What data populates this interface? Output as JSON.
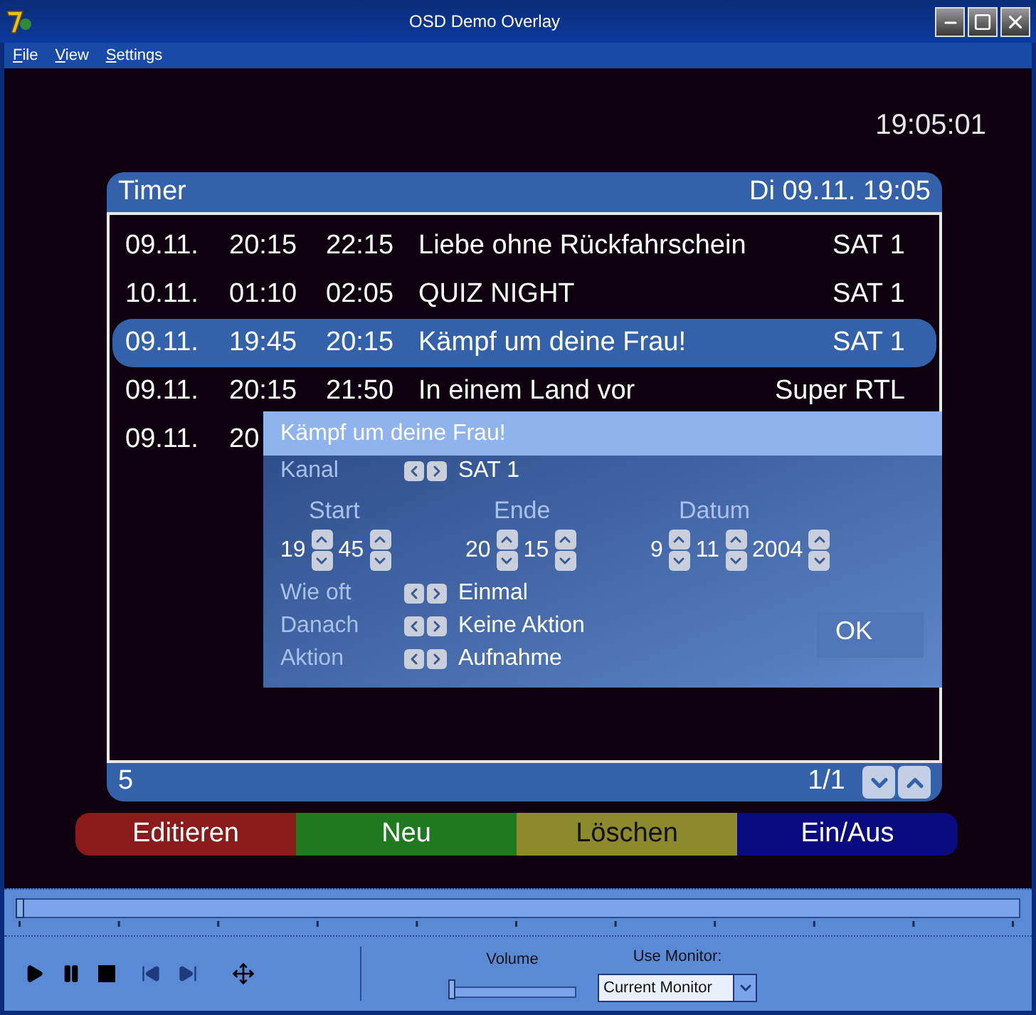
{
  "window": {
    "title": "OSD Demo Overlay"
  },
  "menu": [
    "File",
    "View",
    "Settings"
  ],
  "clock": "19:05:01",
  "timer": {
    "title": "Timer",
    "datetime": "Di 09.11. 19:05",
    "rows": [
      {
        "cells": [
          "09.11.",
          "20:15",
          "22:15",
          "Liebe ohne Rückfahrschein",
          "SAT 1"
        ],
        "selected": false
      },
      {
        "cells": [
          "10.11.",
          "01:10",
          "02:05",
          "QUIZ NIGHT",
          "SAT 1"
        ],
        "selected": false
      },
      {
        "cells": [
          "09.11.",
          "19:45",
          "20:15",
          "Kämpf um deine Frau!",
          "SAT 1"
        ],
        "selected": true
      },
      {
        "cells": [
          "09.11.",
          "20:15",
          "21:50",
          "In einem Land vor",
          "Super RTL"
        ],
        "selected": false
      },
      {
        "cells": [
          "09.11.",
          "20"
        ],
        "selected": false
      }
    ],
    "count": "5",
    "page": "1/1"
  },
  "color_buttons": [
    {
      "label": "Editieren",
      "color": "#8b1a1a"
    },
    {
      "label": "Neu",
      "color": "#1f7a1f"
    },
    {
      "label": "Löschen",
      "color": "#8c8a2a"
    },
    {
      "label": "Ein/Aus",
      "color": "#0a0a80"
    }
  ],
  "dialog": {
    "title": "Kämpf um deine Frau!",
    "channel": {
      "label": "Kanal",
      "value": "SAT 1"
    },
    "spinners": [
      {
        "label": "Start",
        "fields": [
          "19",
          "45"
        ]
      },
      {
        "label": "Ende",
        "fields": [
          "20",
          "15"
        ]
      },
      {
        "label": "Datum",
        "fields": [
          "9",
          "11",
          "2004"
        ]
      }
    ],
    "options": [
      {
        "label": "Wie oft",
        "value": "Einmal"
      },
      {
        "label": "Danach",
        "value": "Keine Aktion"
      },
      {
        "label": "Aktion",
        "value": "Aufnahme"
      }
    ],
    "ok": "OK"
  },
  "player": {
    "position": {
      "level": 0
    },
    "volume": {
      "label": "Volume",
      "level": 0
    },
    "monitor": {
      "label": "Use Monitor:",
      "value": "Current Monitor"
    }
  }
}
